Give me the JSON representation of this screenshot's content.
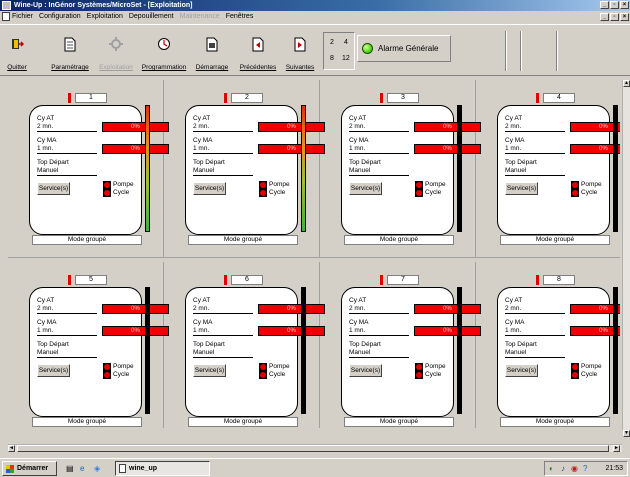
{
  "window": {
    "title": "Wine-Up : InGénor Systèmes/MicroSet - [Exploitation]"
  },
  "menu": [
    {
      "label": "Fichier",
      "enabled": true
    },
    {
      "label": "Configuration",
      "enabled": true
    },
    {
      "label": "Exploitation",
      "enabled": true
    },
    {
      "label": "Depouillement",
      "enabled": true
    },
    {
      "label": "Maintenance",
      "enabled": false
    },
    {
      "label": "Fenêtres",
      "enabled": true
    }
  ],
  "toolbar": {
    "buttons": [
      {
        "label": "Quitter",
        "icon": "exit-door-icon",
        "enabled": true
      },
      {
        "label": "Paramétrage",
        "icon": "document-icon",
        "enabled": true
      },
      {
        "label": "Exploitation",
        "icon": "gear-icon",
        "enabled": false
      },
      {
        "label": "Programmation",
        "icon": "clock-icon",
        "enabled": true
      },
      {
        "label": "Démarrage",
        "icon": "document-icon",
        "enabled": true
      },
      {
        "label": "Précédentes",
        "icon": "previous-icon",
        "enabled": true
      },
      {
        "label": "Suivantes",
        "icon": "next-icon",
        "enabled": true
      }
    ],
    "pager": {
      "a": "2",
      "b": "4",
      "c": "8",
      "d": "12"
    },
    "alarm": {
      "label": "Alarme Générale",
      "color": "#3cd000"
    }
  },
  "tank_labels": {
    "cy_at": "Cy AT",
    "cy_ma": "Cy MA",
    "top_depart": "Top Départ",
    "service": "Service(s)",
    "pompe": "Pompe",
    "cycle": "Cycle"
  },
  "tanks": [
    {
      "number": "1",
      "at_value": "2 mn.",
      "at_pct": "0%",
      "ma_value": "1 mn.",
      "ma_pct": "0%",
      "depart": "Manuel",
      "mode": "Mode groupé",
      "gauge": "gradient"
    },
    {
      "number": "2",
      "at_value": "2 mn.",
      "at_pct": "0%",
      "ma_value": "1 mn.",
      "ma_pct": "0%",
      "depart": "Manuel",
      "mode": "Mode groupé",
      "gauge": "gradient"
    },
    {
      "number": "3",
      "at_value": "2 mn.",
      "at_pct": "0%",
      "ma_value": "1 mn.",
      "ma_pct": "0%",
      "depart": "Manuel",
      "mode": "Mode groupé",
      "gauge": "empty"
    },
    {
      "number": "4",
      "at_value": "2 mn.",
      "at_pct": "0%",
      "ma_value": "1 mn.",
      "ma_pct": "0%",
      "depart": "Manuel",
      "mode": "Mode groupé",
      "gauge": "empty"
    },
    {
      "number": "5",
      "at_value": "2 mn.",
      "at_pct": "0%",
      "ma_value": "1 mn.",
      "ma_pct": "0%",
      "depart": "Manuel",
      "mode": "Mode groupé",
      "gauge": "empty"
    },
    {
      "number": "6",
      "at_value": "2 mn.",
      "at_pct": "0%",
      "ma_value": "1 mn.",
      "ma_pct": "0%",
      "depart": "Manuel",
      "mode": "Mode groupé",
      "gauge": "empty"
    },
    {
      "number": "7",
      "at_value": "2 mn.",
      "at_pct": "0%",
      "ma_value": "1 mn.",
      "ma_pct": "0%",
      "depart": "Manuel",
      "mode": "Mode groupé",
      "gauge": "empty"
    },
    {
      "number": "8",
      "at_value": "2 mn.",
      "at_pct": "0%",
      "ma_value": "1 mn.",
      "ma_pct": "0%",
      "depart": "Manuel",
      "mode": "Mode groupé",
      "gauge": "empty"
    }
  ],
  "taskbar": {
    "start_label": "Démarrer",
    "task_label": "wine_up",
    "clock": "21:53"
  }
}
